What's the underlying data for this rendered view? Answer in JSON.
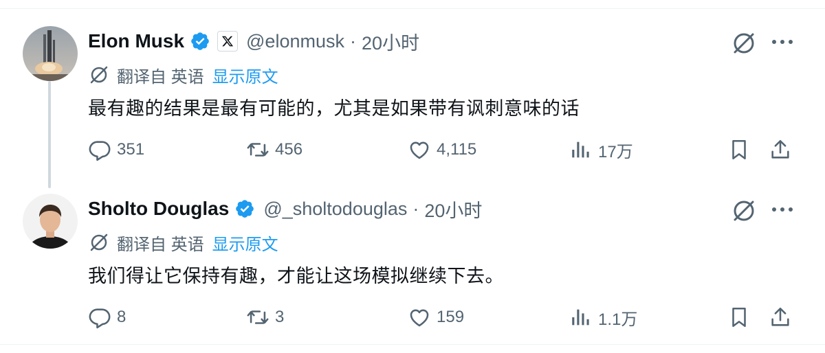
{
  "thread": [
    {
      "name": "Elon Musk",
      "handle": "@elonmusk",
      "separator": "·",
      "time": "20小时",
      "translated_from": "翻译自 英语",
      "show_original": "显示原文",
      "text": "最有趣的结果是最有可能的，尤其是如果带有讽刺意味的话",
      "replies": "351",
      "reposts": "456",
      "likes": "4,115",
      "views": "17万",
      "verified": true,
      "affiliate_badge": "x-logo-icon"
    },
    {
      "name": "Sholto Douglas",
      "handle": "@_sholtodouglas",
      "separator": "·",
      "time": "20小时",
      "translated_from": "翻译自 英语",
      "show_original": "显示原文",
      "text": "我们得让它保持有趣，才能让这场模拟继续下去。",
      "replies": "8",
      "reposts": "3",
      "likes": "159",
      "views": "1.1万",
      "verified": true
    }
  ],
  "colors": {
    "accent": "#1d9bf0",
    "secondary_text": "#536471",
    "primary_text": "#0f1419",
    "divider": "#eff3f4",
    "thread_line": "#cfd9de"
  }
}
